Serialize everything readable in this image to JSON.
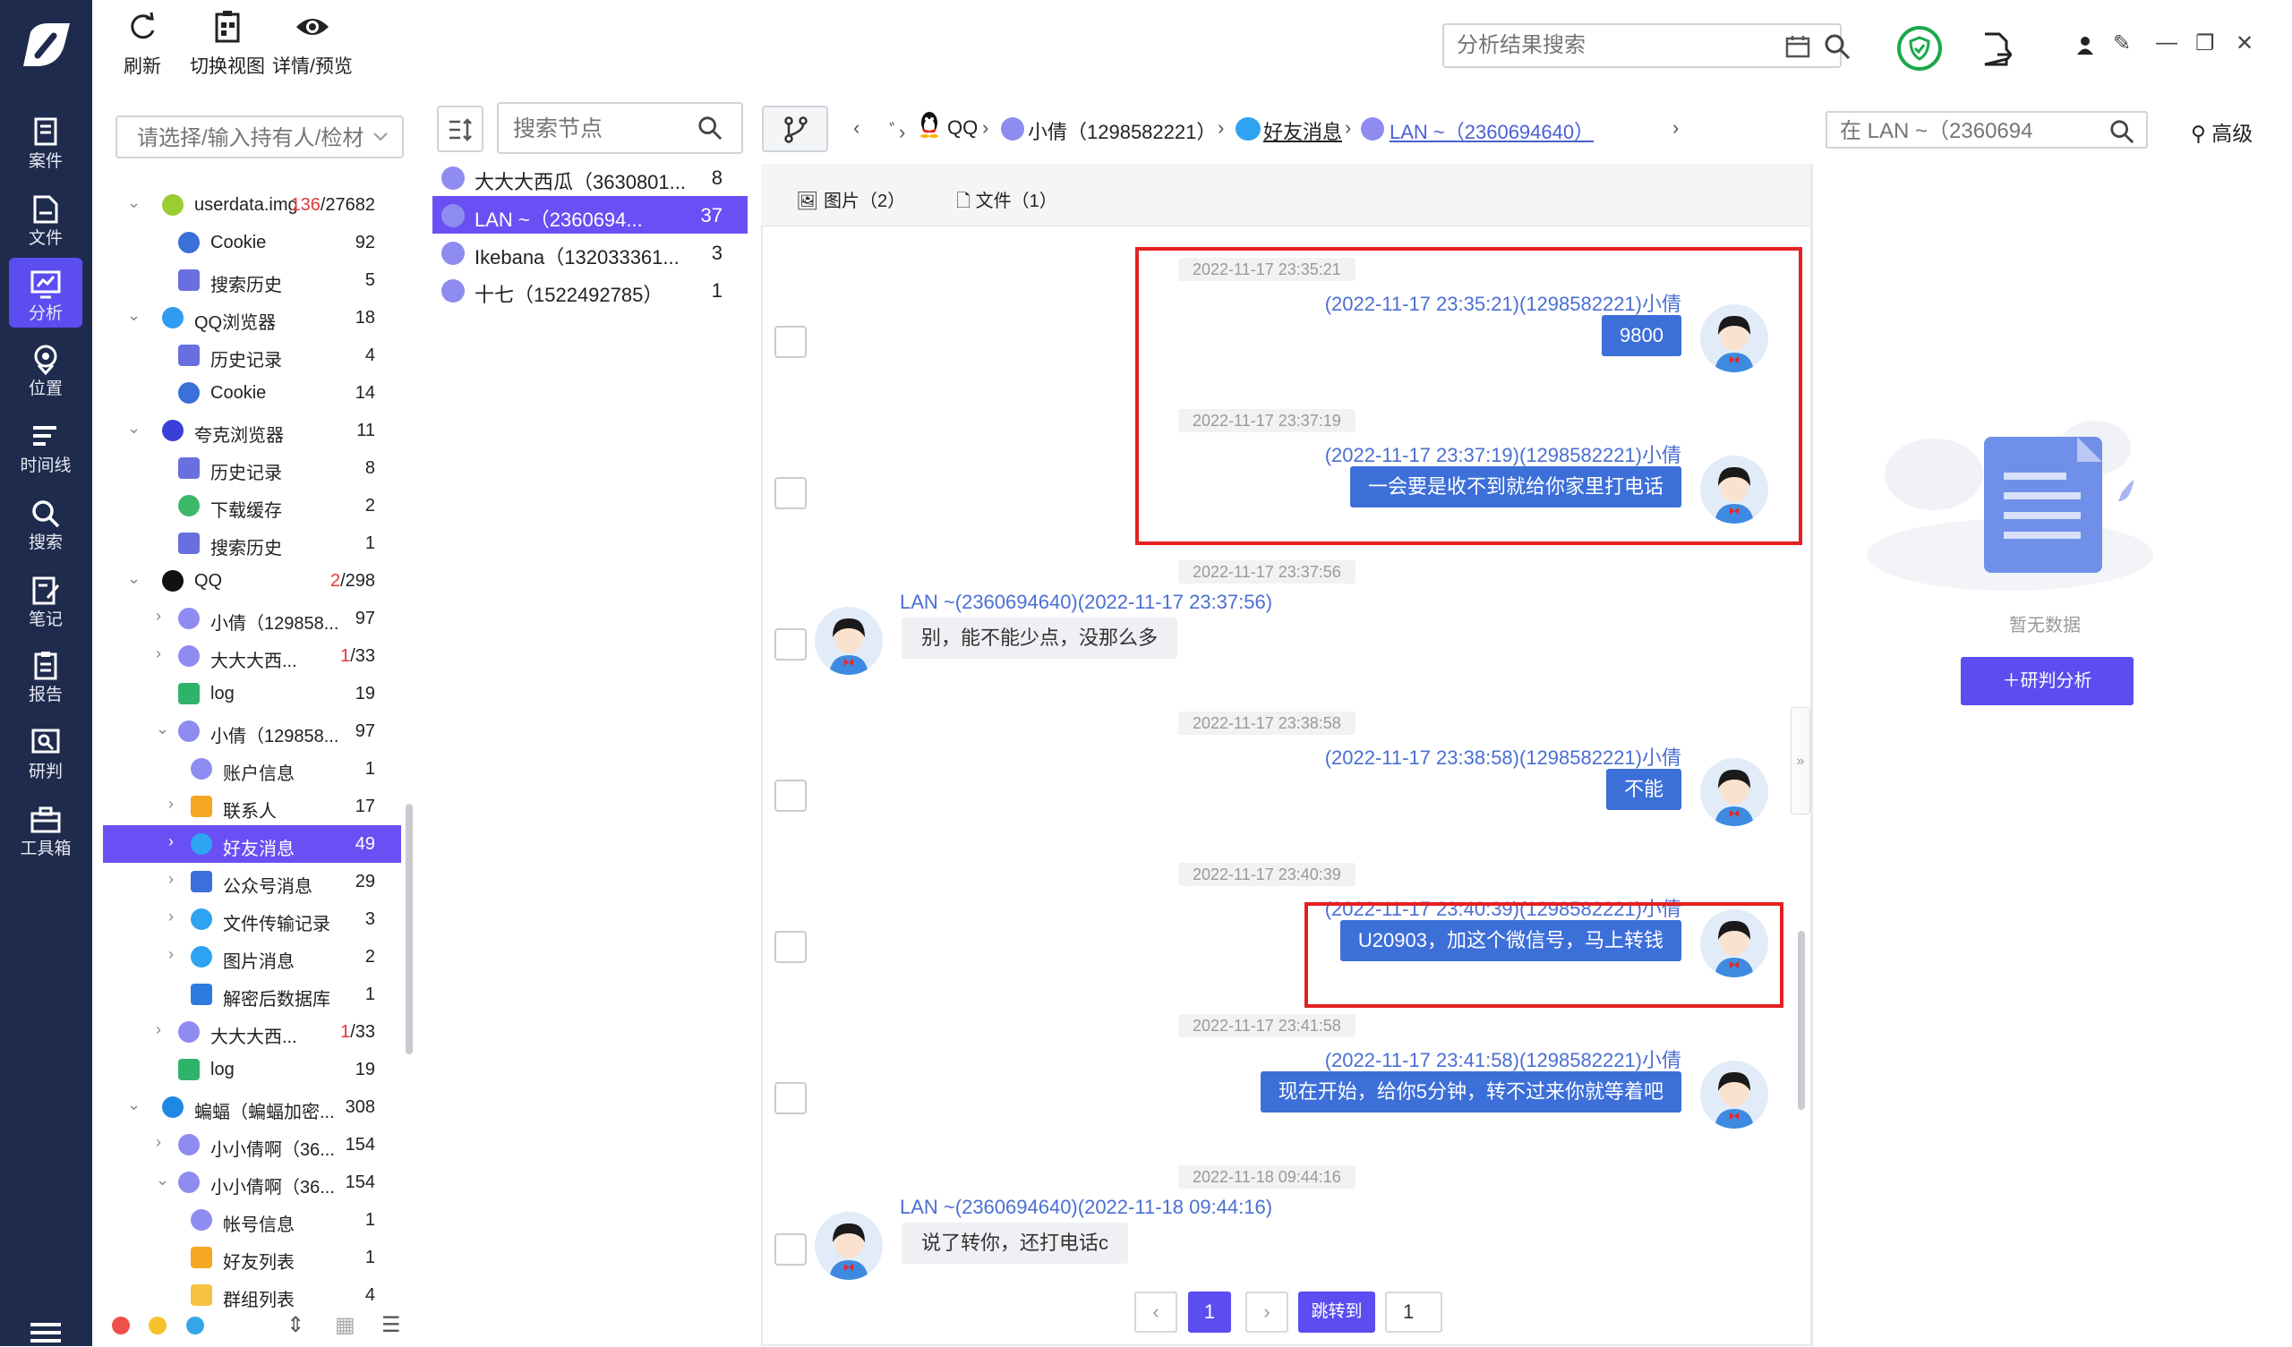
{
  "nav": {
    "items": [
      {
        "label": "案件",
        "icon": "case-icon"
      },
      {
        "label": "文件",
        "icon": "file-icon"
      },
      {
        "label": "分析",
        "icon": "analysis-icon"
      },
      {
        "label": "位置",
        "icon": "location-icon"
      },
      {
        "label": "时间线",
        "icon": "timeline-icon"
      },
      {
        "label": "搜索",
        "icon": "search-icon"
      },
      {
        "label": "笔记",
        "icon": "note-icon"
      },
      {
        "label": "报告",
        "icon": "report-icon"
      },
      {
        "label": "研判",
        "icon": "judge-icon"
      },
      {
        "label": "工具箱",
        "icon": "toolbox-icon"
      }
    ],
    "active_index": 2
  },
  "toolbar": {
    "refresh": "刷新",
    "switch_view": "切换视图",
    "detail_preview": "详情/预览"
  },
  "top_search": {
    "placeholder": "分析结果搜索"
  },
  "tree": {
    "select_placeholder": "请选择/输入持有人/检材",
    "rows": [
      {
        "label": "userdata.img",
        "red": "136",
        "count": "/27682",
        "indent": 0,
        "arrow": "v",
        "icon": "android-icon"
      },
      {
        "label": "Cookie",
        "count": "92",
        "indent": 1,
        "arrow": "",
        "icon": "cookie-icon"
      },
      {
        "label": "搜索历史",
        "count": "5",
        "indent": 1,
        "arrow": "",
        "icon": "history-icon"
      },
      {
        "label": "QQ浏览器",
        "count": "18",
        "indent": 0,
        "arrow": "v",
        "icon": "qq-browser-icon"
      },
      {
        "label": "历史记录",
        "count": "4",
        "indent": 1,
        "arrow": "",
        "icon": "history-icon"
      },
      {
        "label": "Cookie",
        "count": "14",
        "indent": 1,
        "arrow": "",
        "icon": "cookie-icon"
      },
      {
        "label": "夸克浏览器",
        "count": "11",
        "indent": 0,
        "arrow": "v",
        "icon": "quark-browser-icon"
      },
      {
        "label": "历史记录",
        "count": "8",
        "indent": 1,
        "arrow": "",
        "icon": "history-icon"
      },
      {
        "label": "下载缓存",
        "count": "2",
        "indent": 1,
        "arrow": "",
        "icon": "download-icon"
      },
      {
        "label": "搜索历史",
        "count": "1",
        "indent": 1,
        "arrow": "",
        "icon": "history-icon"
      },
      {
        "label": "QQ",
        "red": "2",
        "count": "/298",
        "indent": 0,
        "arrow": "v",
        "icon": "qq-penguin-icon"
      },
      {
        "label": "小倩（129858...",
        "count": "97",
        "indent": 1,
        "arrow": ">",
        "icon": "user-icon"
      },
      {
        "label": "大大大西...",
        "red": "1",
        "count": "/33",
        "indent": 1,
        "arrow": ">",
        "icon": "user-icon"
      },
      {
        "label": "log",
        "count": "19",
        "indent": 1,
        "arrow": "",
        "icon": "log-icon"
      },
      {
        "label": "小倩（129858...",
        "count": "97",
        "indent": 1,
        "arrow": "v",
        "icon": "user-icon"
      },
      {
        "label": "账户信息",
        "count": "1",
        "indent": 2,
        "arrow": "",
        "icon": "user-icon"
      },
      {
        "label": "联系人",
        "count": "17",
        "indent": 2,
        "arrow": ">",
        "icon": "contact-icon"
      },
      {
        "label": "好友消息",
        "count": "49",
        "indent": 2,
        "arrow": ">",
        "icon": "chat-icon",
        "selected": true
      },
      {
        "label": "公众号消息",
        "count": "29",
        "indent": 2,
        "arrow": ">",
        "icon": "official-icon"
      },
      {
        "label": "文件传输记录",
        "count": "3",
        "indent": 2,
        "arrow": ">",
        "icon": "chat-icon"
      },
      {
        "label": "图片消息",
        "count": "2",
        "indent": 2,
        "arrow": ">",
        "icon": "chat-icon"
      },
      {
        "label": "解密后数据库",
        "count": "1",
        "indent": 2,
        "arrow": "",
        "icon": "database-icon"
      },
      {
        "label": "大大大西...",
        "red": "1",
        "count": "/33",
        "indent": 1,
        "arrow": ">",
        "icon": "user-icon"
      },
      {
        "label": "log",
        "count": "19",
        "indent": 1,
        "arrow": "",
        "icon": "log-icon"
      },
      {
        "label": "蝙蝠（蝙蝠加密...",
        "count": "308",
        "indent": 0,
        "arrow": "v",
        "icon": "bat-icon"
      },
      {
        "label": "小小倩啊（36...",
        "count": "154",
        "indent": 1,
        "arrow": ">",
        "icon": "user-icon"
      },
      {
        "label": "小小倩啊（36...",
        "count": "154",
        "indent": 1,
        "arrow": "v",
        "icon": "user-icon"
      },
      {
        "label": "帐号信息",
        "count": "1",
        "indent": 2,
        "arrow": "",
        "icon": "user-icon"
      },
      {
        "label": "好友列表",
        "count": "1",
        "indent": 2,
        "arrow": "",
        "icon": "contact-icon"
      },
      {
        "label": "群组列表",
        "count": "4",
        "indent": 2,
        "arrow": "",
        "icon": "group-icon"
      }
    ]
  },
  "nodes": {
    "search_placeholder": "搜索节点",
    "rows": [
      {
        "label": "大大大西瓜（3630801...",
        "count": "8"
      },
      {
        "label": "LAN ~（2360694...",
        "count": "37",
        "selected": true
      },
      {
        "label": "Ikebana（132033361...",
        "count": "3"
      },
      {
        "label": "十七（1522492785）",
        "count": "1"
      }
    ]
  },
  "breadcrumb": {
    "items": [
      "QQ",
      "小倩（1298582221）",
      "好友消息",
      "LAN ~（2360694640）"
    ],
    "search_placeholder": "在 LAN ~（2360694",
    "advanced": "高级"
  },
  "tabs": {
    "images": "图片（2）",
    "files": "文件（1）"
  },
  "messages": [
    {
      "time": "2022-11-17 23:35:21",
      "dir": "out",
      "sender": "(2022-11-17 23:35:21)(1298582221)小倩",
      "text": "9800"
    },
    {
      "time": "2022-11-17 23:37:19",
      "dir": "out",
      "sender": "(2022-11-17 23:37:19)(1298582221)小倩",
      "text": "一会要是收不到就给你家里打电话"
    },
    {
      "time": "2022-11-17 23:37:56",
      "dir": "in",
      "sender": "LAN ~(2360694640)(2022-11-17 23:37:56)",
      "text": "别，能不能少点，没那么多"
    },
    {
      "time": "2022-11-17 23:38:58",
      "dir": "out",
      "sender": "(2022-11-17 23:38:58)(1298582221)小倩",
      "text": "不能"
    },
    {
      "time": "2022-11-17 23:40:39",
      "dir": "out",
      "sender": "(2022-11-17 23:40:39)(1298582221)小倩",
      "text": "U20903，加这个微信号，马上转钱"
    },
    {
      "time": "2022-11-17 23:41:58",
      "dir": "out",
      "sender": "(2022-11-17 23:41:58)(1298582221)小倩",
      "text": "现在开始，给你5分钟，转不过来你就等着吧"
    },
    {
      "time": "2022-11-18 09:44:16",
      "dir": "in",
      "sender": "LAN ~(2360694640)(2022-11-18 09:44:16)",
      "text": "说了转你，还打电话c"
    }
  ],
  "pager": {
    "current": "1",
    "goto_label": "跳转到",
    "goto_value": "1"
  },
  "right_panel": {
    "empty_text": "暂无数据",
    "judge_button": "＋研判分析"
  },
  "colors": {
    "nav_bg": "#1f2b4d",
    "accent": "#6a4ff5",
    "bubble": "#3d6fd9",
    "highlight": "#e52020"
  }
}
